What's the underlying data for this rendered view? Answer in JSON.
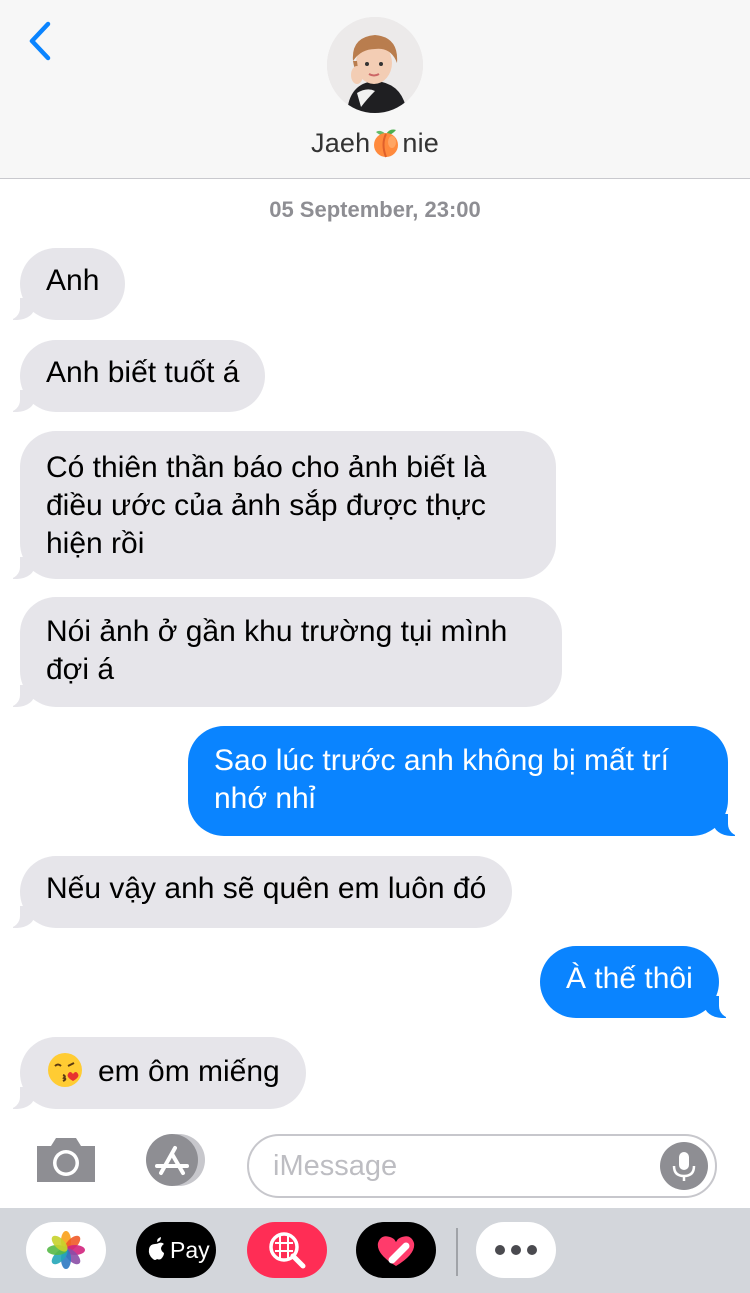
{
  "header": {
    "contact_prefix": "Jaeh",
    "contact_suffix": "nie",
    "back_icon": "chevron-left-icon",
    "accent": "#0a84ff"
  },
  "timestamp": "05 September, 23:00",
  "messages": [
    {
      "from": "them",
      "text": "Anh"
    },
    {
      "from": "them",
      "text": "Anh biết tuốt á"
    },
    {
      "from": "them",
      "lines": [
        "Có thiên thần báo cho ảnh biết là",
        "điều ước của ảnh sắp được thực",
        "hiện rồi"
      ]
    },
    {
      "from": "them",
      "lines": [
        "Nói ảnh ở gần khu trường tụi mình",
        "đợi á"
      ]
    },
    {
      "from": "me",
      "lines": [
        "Sao lúc trước anh không bị mất trí",
        "nhớ nhỉ"
      ]
    },
    {
      "from": "them",
      "text": "Nếu vậy anh sẽ quên em luôn đó"
    },
    {
      "from": "me",
      "text": "À thế thôi"
    },
    {
      "from": "them",
      "text": "em ôm miếng",
      "emoji": "kissing-face-emoji"
    }
  ],
  "input": {
    "placeholder": "iMessage"
  },
  "drawer": {
    "apps": [
      "photos-icon",
      "apple-pay-icon",
      "image-search-icon",
      "digital-touch-icon",
      "more-icon"
    ],
    "pay_label": "Pay"
  }
}
